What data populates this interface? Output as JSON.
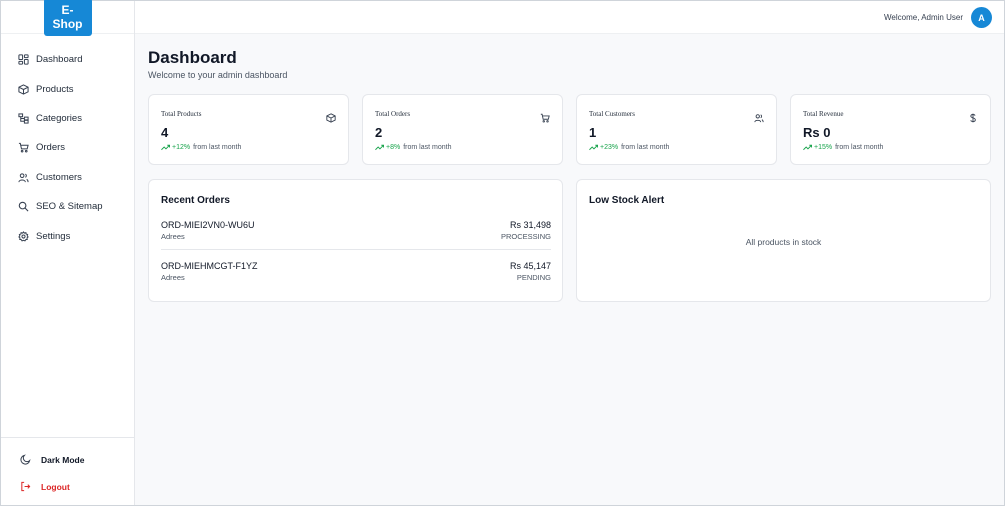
{
  "brand": {
    "name": "E-Shop",
    "color": "#1688d6"
  },
  "sidebar": {
    "items": [
      {
        "label": "Dashboard",
        "icon": "dashboard-icon"
      },
      {
        "label": "Products",
        "icon": "package-icon"
      },
      {
        "label": "Categories",
        "icon": "categories-icon"
      },
      {
        "label": "Orders",
        "icon": "cart-icon"
      },
      {
        "label": "Customers",
        "icon": "users-icon"
      },
      {
        "label": "SEO & Sitemap",
        "icon": "search-icon"
      },
      {
        "label": "Settings",
        "icon": "gear-icon"
      }
    ],
    "dark_mode_label": "Dark Mode",
    "logout_label": "Logout"
  },
  "header": {
    "welcome": "Welcome, Admin User",
    "avatar_initial": "A"
  },
  "main": {
    "title": "Dashboard",
    "subtitle": "Welcome to your admin dashboard",
    "stats": [
      {
        "title": "Total Products",
        "value": "4",
        "change": "+12%",
        "change_suffix": "from last month",
        "icon": "package-icon"
      },
      {
        "title": "Total Orders",
        "value": "2",
        "change": "+8%",
        "change_suffix": "from last month",
        "icon": "cart-icon"
      },
      {
        "title": "Total Customers",
        "value": "1",
        "change": "+23%",
        "change_suffix": "from last month",
        "icon": "users-icon"
      },
      {
        "title": "Total Revenue",
        "value": "Rs 0",
        "change": "+15%",
        "change_suffix": "from last month",
        "icon": "dollar-icon"
      }
    ],
    "recent_orders": {
      "title": "Recent Orders",
      "orders": [
        {
          "id": "ORD-MIEI2VN0-WU6U",
          "customer": "Adrees",
          "amount": "Rs 31,498",
          "status": "PROCESSING"
        },
        {
          "id": "ORD-MIEHMCGT-F1YZ",
          "customer": "Adrees",
          "amount": "Rs 45,147",
          "status": "PENDING"
        }
      ]
    },
    "low_stock": {
      "title": "Low Stock Alert",
      "message": "All products in stock"
    }
  },
  "colors": {
    "accent": "#1688d6",
    "positive": "#16a34a",
    "danger": "#dc2626"
  }
}
